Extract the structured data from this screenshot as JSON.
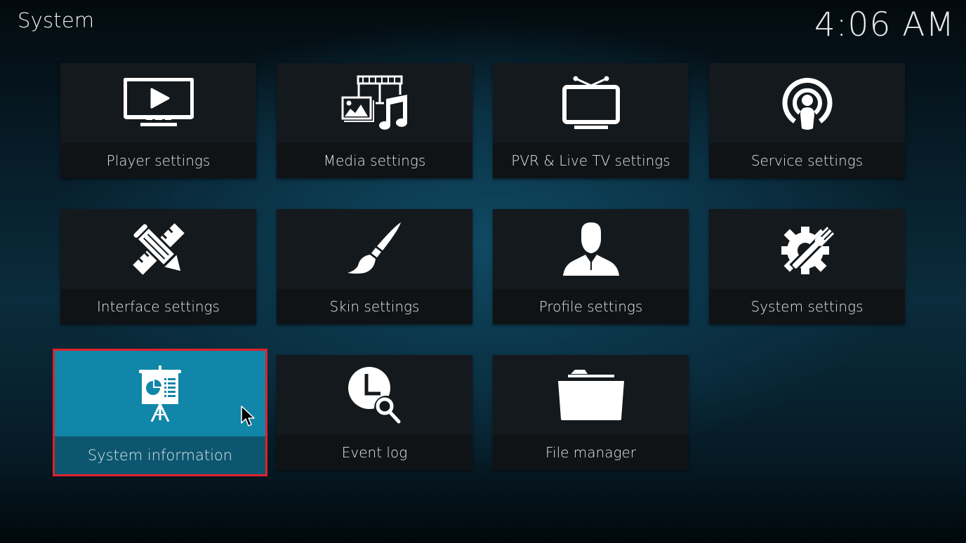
{
  "header": {
    "title": "System",
    "clock": "4:06 AM"
  },
  "focus_color": "#1186a8",
  "highlight_color": "#e3202b",
  "tiles": [
    {
      "label": "Player settings",
      "icon": "monitor-play-icon"
    },
    {
      "label": "Media settings",
      "icon": "media-icon"
    },
    {
      "label": "PVR & Live TV settings",
      "icon": "tv-antenna-icon"
    },
    {
      "label": "Service settings",
      "icon": "broadcast-person-icon"
    },
    {
      "label": "Interface settings",
      "icon": "pencil-ruler-icon"
    },
    {
      "label": "Skin settings",
      "icon": "paintbrush-icon"
    },
    {
      "label": "Profile settings",
      "icon": "user-profile-icon"
    },
    {
      "label": "System settings",
      "icon": "gear-wrench-icon"
    },
    {
      "label": "System information",
      "icon": "presentation-board-icon",
      "focused": true
    },
    {
      "label": "Event log",
      "icon": "clock-search-icon"
    },
    {
      "label": "File manager",
      "icon": "folder-icon"
    }
  ]
}
